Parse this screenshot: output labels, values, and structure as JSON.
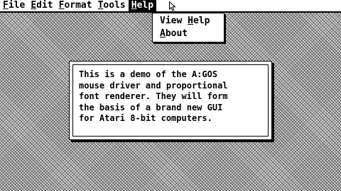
{
  "menubar": {
    "items": [
      {
        "underline": "F",
        "rest": "ile"
      },
      {
        "underline": "E",
        "rest": "dit"
      },
      {
        "underline": "F",
        "rest": "ormat"
      },
      {
        "underline": "T",
        "rest": "ools"
      },
      {
        "underline": "H",
        "rest": "elp"
      }
    ]
  },
  "help_menu": {
    "items": [
      {
        "before": "View ",
        "underline": "H",
        "after": "elp"
      },
      {
        "before": "",
        "underline": "A",
        "after": "bout"
      }
    ]
  },
  "dialog": {
    "lines": [
      "This is a demo of the A:GOS",
      "mouse driver and proportional",
      "font renderer. They will form",
      "the basis of a brand new GUI",
      "for Atari 8-bit computers."
    ]
  },
  "colors": {
    "desktop_light": "#d9d9d9",
    "ink": "#000000",
    "paper": "#ffffff"
  },
  "icons": {
    "pointer": "arrow-cursor-icon"
  }
}
